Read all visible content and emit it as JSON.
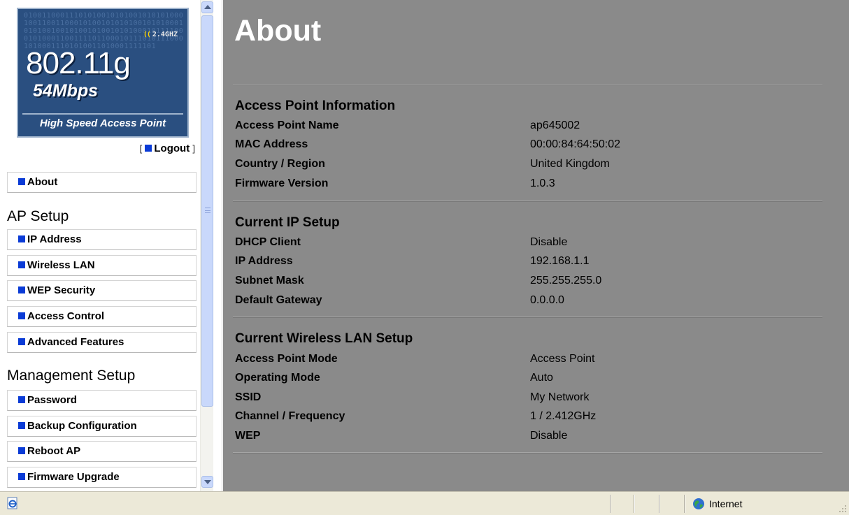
{
  "logo": {
    "binary": "0100110001110101001010100101010100010011001100010100101010100101010001010100100101001010010101000101111000101000110011110110001011101011100010100011101010011010001111101",
    "band": "2.4GHZ",
    "standard": "802.11g",
    "speed": "54Mbps",
    "tagline": "High Speed Access Point"
  },
  "logout": {
    "label": "Logout",
    "open": "[",
    "close": "]"
  },
  "nav": {
    "about": "About",
    "ap_setup": {
      "title": "AP Setup",
      "items": [
        "IP Address",
        "Wireless LAN",
        "WEP Security",
        "Access Control",
        "Advanced Features"
      ]
    },
    "management_setup": {
      "title": "Management Setup",
      "items": [
        "Password",
        "Backup Configuration",
        "Reboot AP",
        "Firmware Upgrade"
      ]
    }
  },
  "page": {
    "title": "About",
    "sections": [
      {
        "title": "Access Point Information",
        "rows": [
          {
            "label": "Access Point Name",
            "value": "ap645002"
          },
          {
            "label": "MAC Address",
            "value": "00:00:84:64:50:02"
          },
          {
            "label": "Country / Region",
            "value": "United Kingdom"
          },
          {
            "label": "Firmware Version",
            "value": "1.0.3"
          }
        ]
      },
      {
        "title": "Current IP Setup",
        "rows": [
          {
            "label": "DHCP Client",
            "value": "Disable"
          },
          {
            "label": "IP Address",
            "value": "192.168.1.1"
          },
          {
            "label": "Subnet Mask",
            "value": "255.255.255.0"
          },
          {
            "label": "Default Gateway",
            "value": "0.0.0.0"
          }
        ]
      },
      {
        "title": "Current Wireless LAN Setup",
        "rows": [
          {
            "label": "Access Point Mode",
            "value": "Access Point"
          },
          {
            "label": "Operating Mode",
            "value": "Auto"
          },
          {
            "label": "SSID",
            "value": "My Network"
          },
          {
            "label": "Channel / Frequency",
            "value": "1 / 2.412GHz"
          },
          {
            "label": "WEP",
            "value": "Disable"
          }
        ]
      }
    ]
  },
  "statusbar": {
    "zone": "Internet"
  },
  "icons": {
    "nav_bullet": "blue-square-bullet-icon",
    "status_page": "ie-page-icon",
    "zone": "globe-icon",
    "resize": "resize-grip-icon"
  },
  "colors": {
    "content_bg": "#8a8a8a",
    "logo_bg": "#2a4f80",
    "bullet": "#0a3bd6",
    "statusbar_bg": "#ece9d8"
  }
}
